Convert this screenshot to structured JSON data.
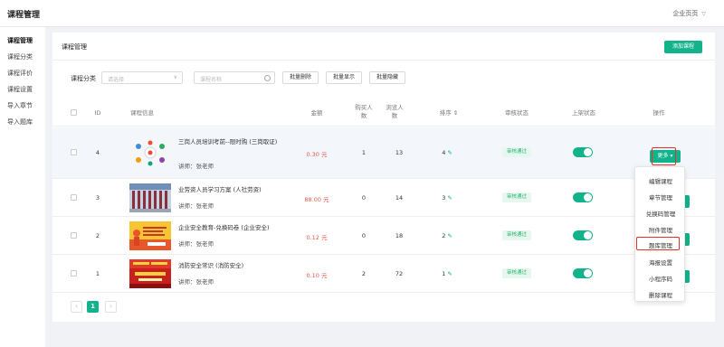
{
  "header": {
    "title": "课程管理",
    "tenant": "企业页页"
  },
  "sidebar": {
    "items": [
      {
        "label": "课程管理"
      },
      {
        "label": "课程分类"
      },
      {
        "label": "课程评价"
      },
      {
        "label": "课程设置"
      },
      {
        "label": "导入章节"
      },
      {
        "label": "导入题库"
      }
    ]
  },
  "panel": {
    "title": "课程管理",
    "add_label": "添加课程"
  },
  "filters": {
    "category_label": "课程分类",
    "category_placeholder": "请选择",
    "name_placeholder": "课程名称",
    "buttons": [
      "批量删除",
      "批量显示",
      "批量隐藏"
    ]
  },
  "table": {
    "headers": {
      "id": "ID",
      "info": "课程信息",
      "price": "金额",
      "buyers": "购买人数",
      "views": "浏览人数",
      "sort": "排序 ⇕",
      "audit": "审核状态",
      "shelf": "上架状态",
      "ops": "操作"
    },
    "rows": [
      {
        "id": "4",
        "name": "三岗人员培训考前--限时购 (三岗取证)",
        "teacher": "讲师：张老师",
        "price": "0.30 元",
        "buyers": "1",
        "views": "13",
        "sort": "4",
        "audit": "审核通过"
      },
      {
        "id": "3",
        "name": "业劳资人员学习方案 (人社劳资)",
        "teacher": "讲师：张老师",
        "price": "88.00 元",
        "buyers": "0",
        "views": "14",
        "sort": "3",
        "audit": "审核通过"
      },
      {
        "id": "2",
        "name": "企业安全教育-兑换码卷 (企业安全)",
        "teacher": "讲师：张老师",
        "price": "0.12 元",
        "buyers": "0",
        "views": "18",
        "sort": "2",
        "audit": "审核通过"
      },
      {
        "id": "1",
        "name": "消防安全常识 (消防安全)",
        "teacher": "讲师：张老师",
        "price": "0.10 元",
        "buyers": "2",
        "views": "72",
        "sort": "1",
        "audit": "审核通过"
      }
    ],
    "more_label": "更多 ▾"
  },
  "dropdown": {
    "items": [
      "编辑课程",
      "章节管理",
      "兑换码管理",
      "附件管理",
      "题库管理",
      "海报设置",
      "小程序码",
      "删除课程"
    ]
  },
  "pagination": {
    "prev": "‹",
    "current": "1",
    "next": "›"
  },
  "colors": {
    "accent": "#12b28b",
    "price": "#e05a4b",
    "highlight": "#e0322a"
  }
}
